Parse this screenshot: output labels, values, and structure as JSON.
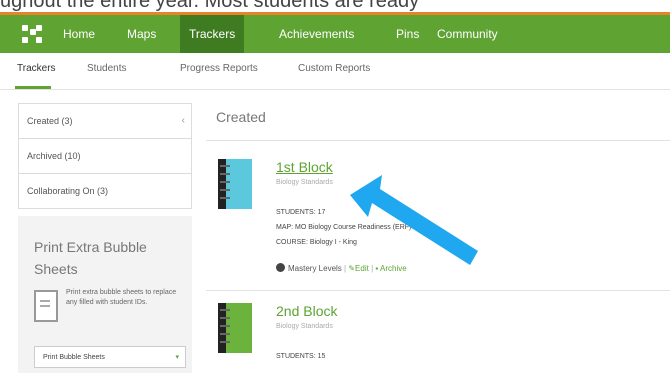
{
  "topstrip": {
    "text": "ughout the entire year. Most students are ready"
  },
  "nav": {
    "items": [
      {
        "label": "Home"
      },
      {
        "label": "Maps"
      },
      {
        "label": "Trackers",
        "active": true
      },
      {
        "label": "Achievements"
      },
      {
        "label": "Pins"
      },
      {
        "label": "Community"
      }
    ]
  },
  "subnav": {
    "items": [
      {
        "label": "Trackers",
        "active": true
      },
      {
        "label": "Students"
      },
      {
        "label": "Progress Reports"
      },
      {
        "label": "Custom Reports"
      }
    ]
  },
  "sidebar": {
    "items": [
      {
        "label": "Created (3)"
      },
      {
        "label": "Archived (10)"
      },
      {
        "label": "Collaborating On (3)"
      }
    ]
  },
  "print": {
    "title": "Print Extra Bubble Sheets",
    "description": "Print extra bubble sheets to replace any filled with student IDs.",
    "button_label": "Print Bubble Sheets"
  },
  "main": {
    "heading": "Created",
    "trackers": [
      {
        "title": "1st Block",
        "subtitle": "Biology Standards",
        "meta": [
          "STUDENTS: 17",
          "MAP: MO Biology Course Readiness (ERF)",
          "COURSE: Biology I - King"
        ],
        "actions": {
          "mastery": "Mastery Levels",
          "edit": "Edit",
          "archive": "Archive"
        },
        "color": "#5bc8dd"
      },
      {
        "title": "2nd Block",
        "subtitle": "Biology Standards",
        "meta": [
          "STUDENTS: 15"
        ],
        "color": "#6cb33e"
      }
    ]
  },
  "colors": {
    "brand_green": "#5fa333",
    "active_nav": "#3f7c21",
    "arrow": "#1fa7f0",
    "accent_orange": "#e8832a"
  }
}
